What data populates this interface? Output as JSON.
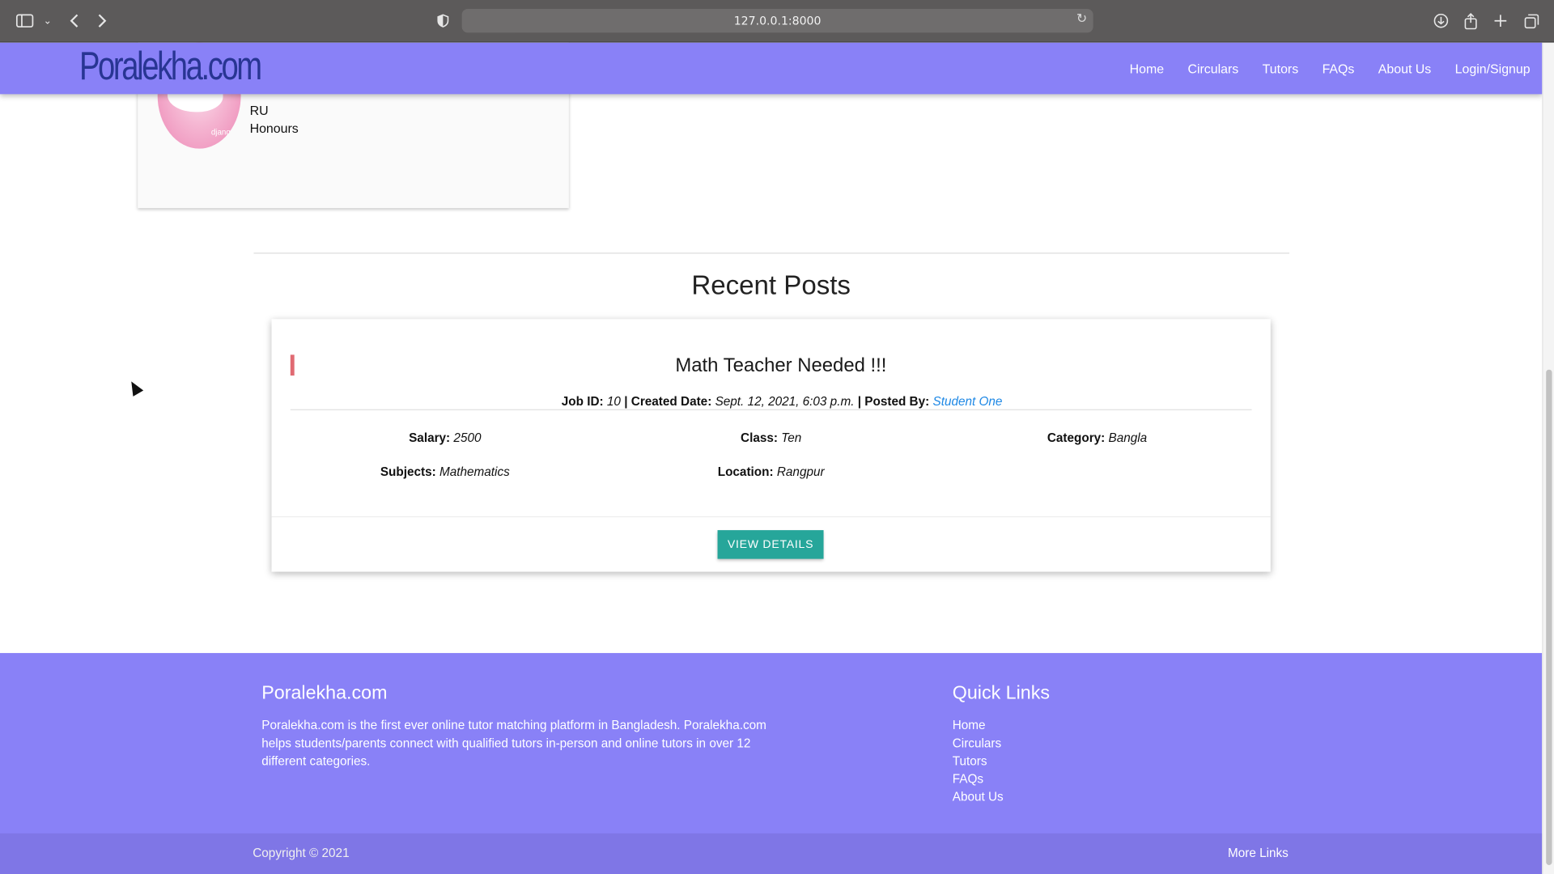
{
  "browser": {
    "url": "127.0.0.1:8000",
    "icons": {
      "sidebar": "sidebar-icon",
      "back": "chevron-left-icon",
      "forward": "chevron-right-icon",
      "shield": "shield-icon",
      "reload": "reload-icon",
      "download": "download-icon",
      "share": "share-icon",
      "new_tab": "plus-icon",
      "tabs": "tabs-overview-icon"
    }
  },
  "navbar": {
    "brand": "Poralekha.com",
    "links": [
      "Home",
      "Circulars",
      "Tutors",
      "FAQs",
      "About Us",
      "Login/Signup"
    ]
  },
  "profile": {
    "lines": [
      "RU",
      "Honours"
    ],
    "avatar_caption": "django"
  },
  "recent_posts": {
    "heading": "Recent Posts",
    "posts": [
      {
        "title": "Math Teacher Needed !!!",
        "job_id_label": "Job ID:",
        "job_id": "10",
        "created_label": "Created Date:",
        "created": "Sept. 12, 2021, 6:03 p.m.",
        "posted_by_label": "Posted By:",
        "posted_by": "Student One",
        "salary_label": "Salary:",
        "salary": "2500",
        "class_label": "Class:",
        "class": "Ten",
        "category_label": "Category:",
        "category": "Bangla",
        "subjects_label": "Subjects:",
        "subjects": "Mathematics",
        "location_label": "Location:",
        "location": "Rangpur",
        "button": "VIEW DETAILS"
      }
    ]
  },
  "footer": {
    "brand": "Poralekha.com",
    "description": "Poralekha.com is the first ever online tutor matching platform in Bangladesh. Poralekha.com helps students/parents connect with qualified tutors in-person and online tutors in over 12 different categories.",
    "quick_links_title": "Quick Links",
    "quick_links": [
      "Home",
      "Circulars",
      "Tutors",
      "FAQs",
      "About Us"
    ],
    "copyright": "Copyright © 2021",
    "more_links": "More Links"
  },
  "colors": {
    "navbar": "#8981f7",
    "footer_bottom": "#7f76e6",
    "logo": "#283593",
    "button": "#26a69a",
    "link": "#1e88e5",
    "accent": "#e06a72"
  }
}
